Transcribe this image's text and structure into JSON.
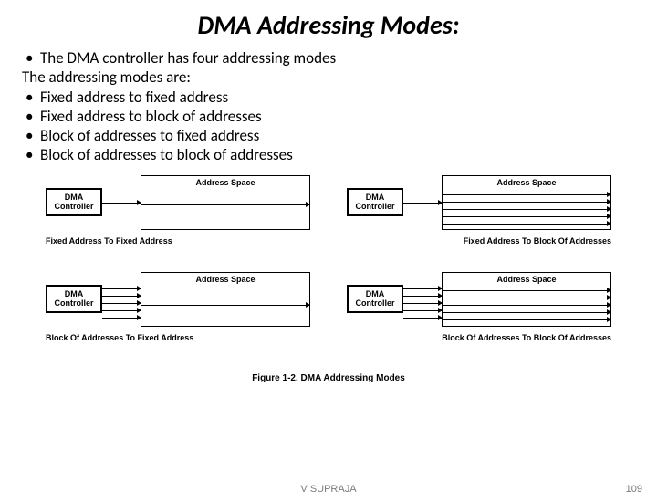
{
  "title": "DMA Addressing Modes:",
  "intro_bullet": "The DMA controller has four addressing modes",
  "intro_line": "The addressing modes are:",
  "bullets": [
    "Fixed address to fixed address",
    "Fixed address to block of addresses",
    "Block of addresses to fixed address",
    "Block of addresses to block of addresses"
  ],
  "diagram_labels": {
    "dma": "DMA Controller",
    "addr": "Address Space"
  },
  "captions": [
    "Fixed Address To Fixed Address",
    "Fixed Address To Block Of Addresses",
    "Block Of Addresses To Fixed Address",
    "Block Of Addresses To Block Of Addresses"
  ],
  "figure_caption": "Figure 1-2. DMA Addressing Modes",
  "author": "V SUPRAJA",
  "page": "109"
}
